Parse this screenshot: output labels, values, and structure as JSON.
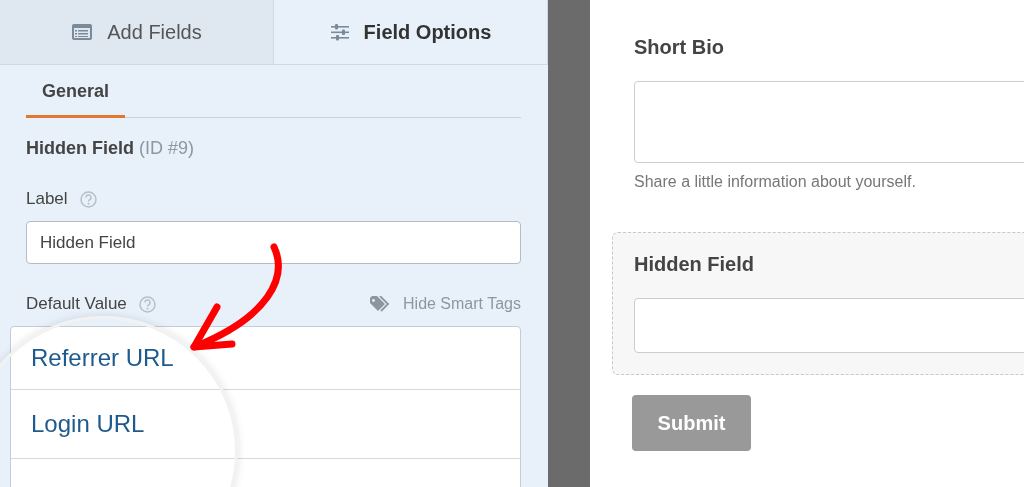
{
  "tabs": [
    {
      "label": "Add Fields",
      "kind": "fields",
      "selected": false
    },
    {
      "label": "Field Options",
      "kind": "options",
      "selected": true
    }
  ],
  "subtabs": [
    {
      "label": "General",
      "selected": true
    }
  ],
  "field_options": {
    "field_name": "Hidden Field",
    "field_id": "(ID #9)",
    "label": {
      "label": "Label",
      "value": "Hidden Field"
    },
    "default_value": {
      "label": "Default Value",
      "smart_tags_toggle": "Hide Smart Tags",
      "smart_tags": [
        "Referrer URL",
        "Login URL"
      ]
    }
  },
  "form_preview": {
    "fields": [
      {
        "kind": "textarea",
        "label": "Short Bio",
        "description": "Share a little information about yourself.",
        "selected": false
      },
      {
        "kind": "text",
        "label": "Hidden Field",
        "selected": true
      }
    ],
    "submit": "Submit"
  }
}
